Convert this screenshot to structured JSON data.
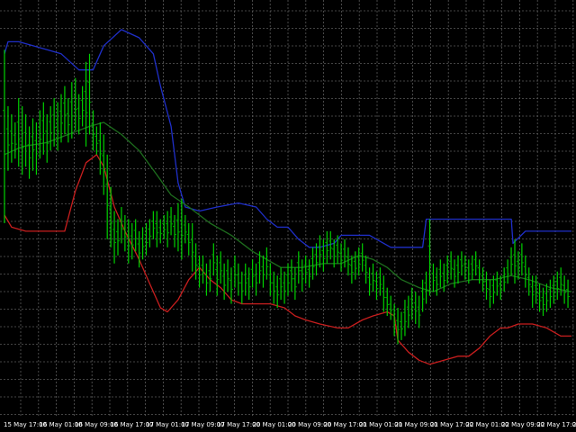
{
  "chart_data": {
    "type": "line",
    "background": "#000000",
    "grid": true,
    "grid_color": "#5a5a5a",
    "x_tick_labels": [
      "15 May 17:00",
      "16 May 01:00",
      "16 May 09:00",
      "16 May 17:00",
      "17 May 01:00",
      "17 May 09:00",
      "17 May 17:00",
      "20 May 01:00",
      "20 May 09:00",
      "20 May 17:00",
      "21 May 01:00",
      "21 May 09:00",
      "21 May 17:00",
      "22 May 01:00",
      "22 May 09:00",
      "22 May 17:00",
      "23"
    ],
    "series": [
      {
        "key": "upper",
        "color": "#1f2fc8",
        "values": [
          [
            0,
            90
          ],
          [
            1,
            93
          ],
          [
            4,
            93
          ],
          [
            8,
            92
          ],
          [
            12,
            91
          ],
          [
            16,
            90
          ],
          [
            21,
            86
          ],
          [
            25,
            86
          ],
          [
            28,
            92
          ],
          [
            33,
            96
          ],
          [
            38,
            94
          ],
          [
            42,
            90
          ],
          [
            44,
            82
          ],
          [
            47,
            72
          ],
          [
            49,
            58
          ],
          [
            51,
            52
          ],
          [
            55,
            51
          ],
          [
            60,
            52
          ],
          [
            66,
            53
          ],
          [
            71,
            52
          ],
          [
            74,
            49
          ],
          [
            77,
            47
          ],
          [
            80,
            47
          ],
          [
            83,
            44
          ],
          [
            86,
            42
          ],
          [
            89,
            42
          ],
          [
            93,
            43
          ],
          [
            95,
            45
          ],
          [
            99,
            45
          ],
          [
            103,
            45
          ],
          [
            105,
            44
          ],
          [
            109,
            42
          ],
          [
            112,
            42
          ],
          [
            116,
            42
          ],
          [
            118,
            42
          ],
          [
            119,
            49
          ],
          [
            123,
            49
          ],
          [
            132,
            49
          ],
          [
            141,
            49
          ],
          [
            143,
            49
          ],
          [
            143.5,
            43
          ],
          [
            147,
            46
          ],
          [
            150,
            46
          ],
          [
            155,
            46
          ],
          [
            160,
            46
          ]
        ]
      },
      {
        "key": "middle",
        "color": "#1e6e1e",
        "values": [
          [
            0,
            65
          ],
          [
            5,
            67
          ],
          [
            12,
            68
          ],
          [
            18,
            70
          ],
          [
            24,
            72
          ],
          [
            28,
            73
          ],
          [
            33,
            70
          ],
          [
            38,
            66
          ],
          [
            43,
            60
          ],
          [
            47,
            55
          ],
          [
            52,
            52
          ],
          [
            58,
            48
          ],
          [
            64,
            45
          ],
          [
            70,
            41
          ],
          [
            74,
            39
          ],
          [
            78,
            37
          ],
          [
            84,
            37
          ],
          [
            90,
            38
          ],
          [
            95,
            38
          ],
          [
            100,
            40
          ],
          [
            104,
            39
          ],
          [
            108,
            37
          ],
          [
            112,
            34
          ],
          [
            117,
            32
          ],
          [
            121,
            31
          ],
          [
            126,
            33
          ],
          [
            132,
            34
          ],
          [
            138,
            34
          ],
          [
            143,
            35
          ],
          [
            148,
            34
          ],
          [
            154,
            32
          ],
          [
            160,
            31
          ]
        ]
      },
      {
        "key": "lower",
        "color": "#c81e1e",
        "values": [
          [
            0,
            50
          ],
          [
            2,
            47
          ],
          [
            6,
            46
          ],
          [
            12,
            46
          ],
          [
            17,
            46
          ],
          [
            20,
            56
          ],
          [
            23,
            63
          ],
          [
            26,
            65
          ],
          [
            28,
            62
          ],
          [
            31,
            52
          ],
          [
            34,
            46
          ],
          [
            38,
            39
          ],
          [
            41,
            33
          ],
          [
            44,
            27
          ],
          [
            46,
            26
          ],
          [
            49,
            29
          ],
          [
            52,
            34
          ],
          [
            55,
            37
          ],
          [
            58,
            34
          ],
          [
            61,
            32
          ],
          [
            64,
            29
          ],
          [
            67,
            28
          ],
          [
            71,
            28
          ],
          [
            75,
            28
          ],
          [
            79,
            27
          ],
          [
            82,
            25
          ],
          [
            85,
            24
          ],
          [
            89,
            23
          ],
          [
            94,
            22
          ],
          [
            97,
            22
          ],
          [
            101,
            24
          ],
          [
            104,
            25
          ],
          [
            108,
            26
          ],
          [
            110,
            25
          ],
          [
            111,
            19
          ],
          [
            114,
            16
          ],
          [
            117,
            14
          ],
          [
            120,
            13
          ],
          [
            124,
            14
          ],
          [
            128,
            15
          ],
          [
            131,
            15
          ],
          [
            134,
            17
          ],
          [
            137,
            20
          ],
          [
            140,
            22
          ],
          [
            142,
            22
          ],
          [
            145,
            23
          ],
          [
            149,
            23
          ],
          [
            153,
            22
          ],
          [
            157,
            20
          ],
          [
            160,
            20
          ]
        ]
      },
      {
        "key": "price",
        "type": "ohlc",
        "color": "#00d000",
        "wick_color": "#00a000",
        "values": [
          [
            0,
            48,
            91
          ],
          [
            1,
            61,
            77
          ],
          [
            2,
            63,
            75
          ],
          [
            3,
            64,
            73
          ],
          [
            4,
            62,
            79
          ],
          [
            5,
            60,
            77
          ],
          [
            6,
            62,
            75
          ],
          [
            7,
            59,
            72
          ],
          [
            8,
            61,
            74
          ],
          [
            9,
            60,
            73
          ],
          [
            10,
            64,
            76
          ],
          [
            11,
            65,
            78
          ],
          [
            12,
            63,
            75
          ],
          [
            13,
            66,
            77
          ],
          [
            14,
            67,
            79
          ],
          [
            15,
            66,
            78
          ],
          [
            16,
            68,
            80
          ],
          [
            17,
            70,
            82
          ],
          [
            18,
            68,
            79
          ],
          [
            19,
            69,
            83
          ],
          [
            20,
            71,
            84
          ],
          [
            21,
            70,
            80
          ],
          [
            22,
            72,
            82
          ],
          [
            23,
            67,
            88
          ],
          [
            24,
            70,
            90
          ],
          [
            25,
            66,
            76
          ],
          [
            26,
            65,
            72
          ],
          [
            27,
            60,
            73
          ],
          [
            28,
            55,
            70
          ],
          [
            29,
            44,
            65
          ],
          [
            30,
            42,
            57
          ],
          [
            31,
            38,
            51
          ],
          [
            32,
            40,
            49
          ],
          [
            33,
            43,
            52
          ],
          [
            34,
            41,
            50
          ],
          [
            35,
            38,
            49
          ],
          [
            36,
            39,
            48
          ],
          [
            37,
            41,
            49
          ],
          [
            38,
            37,
            46
          ],
          [
            39,
            39,
            47
          ],
          [
            40,
            40,
            48
          ],
          [
            41,
            42,
            49
          ],
          [
            42,
            44,
            51
          ],
          [
            43,
            42,
            51
          ],
          [
            44,
            43,
            49
          ],
          [
            45,
            44,
            50
          ],
          [
            46,
            42,
            51
          ],
          [
            47,
            45,
            52
          ],
          [
            48,
            42,
            50
          ],
          [
            49,
            41,
            53
          ],
          [
            50,
            39,
            54
          ],
          [
            51,
            43,
            50
          ],
          [
            52,
            40,
            48
          ],
          [
            53,
            36,
            48
          ],
          [
            54,
            34,
            43
          ],
          [
            55,
            32,
            40
          ],
          [
            56,
            33,
            40
          ],
          [
            57,
            30,
            38
          ],
          [
            58,
            31,
            39
          ],
          [
            59,
            35,
            43
          ],
          [
            60,
            30,
            40
          ],
          [
            61,
            33,
            41
          ],
          [
            62,
            29,
            38
          ],
          [
            63,
            31,
            39
          ],
          [
            64,
            28,
            37
          ],
          [
            65,
            32,
            40
          ],
          [
            66,
            30,
            38
          ],
          [
            67,
            28,
            36
          ],
          [
            68,
            30,
            38
          ],
          [
            69,
            29,
            37
          ],
          [
            70,
            32,
            39
          ],
          [
            71,
            30,
            38
          ],
          [
            72,
            33,
            41
          ],
          [
            73,
            32,
            40
          ],
          [
            74,
            34,
            42
          ],
          [
            75,
            30,
            38
          ],
          [
            76,
            28,
            36
          ],
          [
            77,
            27,
            35
          ],
          [
            78,
            29,
            37
          ],
          [
            79,
            28,
            36
          ],
          [
            80,
            30,
            38
          ],
          [
            81,
            31,
            39
          ],
          [
            82,
            29,
            37
          ],
          [
            83,
            33,
            41
          ],
          [
            84,
            31,
            39
          ],
          [
            85,
            33,
            40
          ],
          [
            86,
            32,
            39
          ],
          [
            87,
            34,
            42
          ],
          [
            88,
            35,
            43
          ],
          [
            89,
            37,
            45
          ],
          [
            90,
            36,
            44
          ],
          [
            91,
            38,
            46
          ],
          [
            92,
            39,
            46
          ],
          [
            93,
            37,
            44
          ],
          [
            94,
            38,
            45
          ],
          [
            95,
            36,
            43
          ],
          [
            96,
            37,
            44
          ],
          [
            97,
            35,
            42
          ],
          [
            98,
            33,
            40
          ],
          [
            99,
            34,
            41
          ],
          [
            100,
            35,
            42
          ],
          [
            101,
            36,
            43
          ],
          [
            102,
            33,
            40
          ],
          [
            103,
            30,
            37
          ],
          [
            104,
            31,
            38
          ],
          [
            105,
            29,
            36
          ],
          [
            106,
            30,
            37
          ],
          [
            107,
            26,
            35
          ],
          [
            108,
            25,
            32
          ],
          [
            109,
            24,
            30
          ],
          [
            110,
            20,
            28
          ],
          [
            111,
            18,
            27
          ],
          [
            112,
            19,
            26
          ],
          [
            113,
            20,
            29
          ],
          [
            114,
            22,
            30
          ],
          [
            115,
            24,
            32
          ],
          [
            116,
            23,
            31
          ],
          [
            117,
            22,
            30
          ],
          [
            118,
            26,
            34
          ],
          [
            119,
            28,
            36
          ],
          [
            120,
            30,
            49
          ],
          [
            121,
            31,
            38
          ],
          [
            122,
            30,
            37
          ],
          [
            123,
            32,
            39
          ],
          [
            124,
            31,
            38
          ],
          [
            125,
            33,
            40
          ],
          [
            126,
            34,
            41
          ],
          [
            127,
            32,
            39
          ],
          [
            128,
            33,
            40
          ],
          [
            129,
            35,
            41
          ],
          [
            130,
            34,
            40
          ],
          [
            131,
            33,
            39
          ],
          [
            132,
            34,
            40
          ],
          [
            133,
            35,
            41
          ],
          [
            134,
            33,
            39
          ],
          [
            135,
            31,
            37
          ],
          [
            136,
            29,
            36
          ],
          [
            137,
            27,
            34
          ],
          [
            138,
            28,
            35
          ],
          [
            139,
            30,
            36
          ],
          [
            140,
            29,
            35
          ],
          [
            141,
            31,
            37
          ],
          [
            142,
            33,
            39
          ],
          [
            143,
            35,
            42
          ],
          [
            144,
            33,
            44
          ],
          [
            145,
            34,
            41
          ],
          [
            146,
            35,
            43
          ],
          [
            147,
            32,
            40
          ],
          [
            148,
            30,
            37
          ],
          [
            149,
            27,
            35
          ],
          [
            150,
            28,
            35
          ],
          [
            151,
            26,
            33
          ],
          [
            152,
            25,
            32
          ],
          [
            153,
            26,
            33
          ],
          [
            154,
            27,
            34
          ],
          [
            155,
            28,
            35
          ],
          [
            156,
            29,
            36
          ],
          [
            157,
            30,
            37
          ],
          [
            158,
            28,
            35
          ],
          [
            159,
            27,
            34
          ]
        ]
      }
    ],
    "x_range": [
      0,
      160
    ],
    "y_range": [
      0,
      100
    ]
  }
}
